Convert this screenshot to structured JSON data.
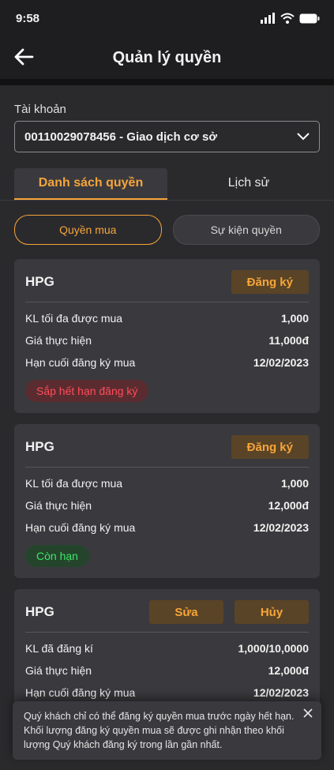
{
  "status_bar": {
    "time": "9:58"
  },
  "header": {
    "title": "Quản lý quyền"
  },
  "account": {
    "label": "Tài khoản",
    "selected": "00110029078456 - Giao dịch cơ sở"
  },
  "tabs": [
    {
      "label": "Danh sách quyền",
      "active": true
    },
    {
      "label": "Lịch sử",
      "active": false
    }
  ],
  "filters": [
    {
      "label": "Quyền mua",
      "active": true
    },
    {
      "label": "Sự kiện quyền",
      "active": false
    }
  ],
  "cards": [
    {
      "symbol": "HPG",
      "actions": [
        "Đăng ký"
      ],
      "rows": [
        {
          "label": "KL tối đa được mua",
          "value": "1,000"
        },
        {
          "label": "Giá thực hiện",
          "value": "11,000đ"
        },
        {
          "label": "Hạn cuối đăng ký mua",
          "value": "12/02/2023"
        }
      ],
      "badge": "Sắp hết hạn đăng ký"
    },
    {
      "symbol": "HPG",
      "actions": [
        "Đăng ký"
      ],
      "rows": [
        {
          "label": "KL tối đa được mua",
          "value": "1,000"
        },
        {
          "label": "Giá thực hiện",
          "value": "12,000đ"
        },
        {
          "label": "Hạn cuối đăng ký mua",
          "value": "12/02/2023"
        }
      ],
      "badge": "Còn hạn"
    },
    {
      "symbol": "HPG",
      "actions": [
        "Sửa",
        "Hủy"
      ],
      "rows": [
        {
          "label": "KL đã đăng kí",
          "value": "1,000/10,0000"
        },
        {
          "label": "Giá thực hiện",
          "value": "12,000đ"
        },
        {
          "label": "Hạn cuối đăng ký mua",
          "value": "12/02/2023"
        }
      ]
    }
  ],
  "toast": {
    "text": "Quý khách chỉ có thể đăng ký quyền mua trước ngày hết hạn. Khối lượng đăng ký quyền mua sẽ được ghi nhận theo khối lượng Quý khách đăng ký trong lần gần nhất."
  }
}
